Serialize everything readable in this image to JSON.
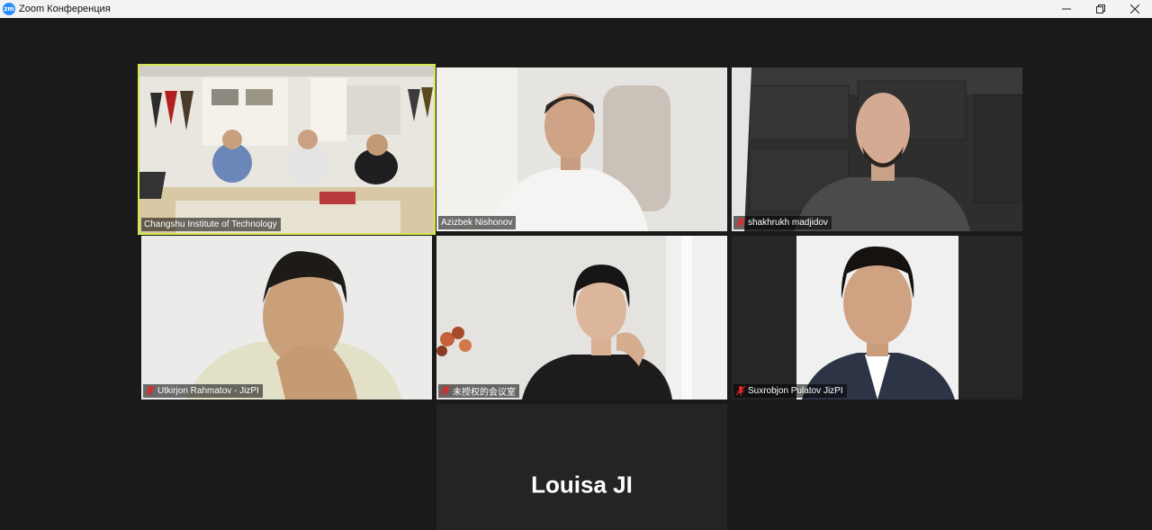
{
  "window": {
    "app_icon_text": "zm",
    "title": "Zoom Конференция",
    "minimize_icon": "minimize-icon",
    "restore_icon": "restore-icon",
    "close_icon": "close-icon"
  },
  "participants": [
    {
      "name": "Changshu Institute of Technology",
      "muted": false,
      "active_speaker": true
    },
    {
      "name": "Azizbek Nishonov",
      "muted": false,
      "active_speaker": false
    },
    {
      "name": "shakhrukh madjidov",
      "muted": true,
      "active_speaker": false
    },
    {
      "name": "Utkirjon Rahmatov - JizPI",
      "muted": true,
      "active_speaker": false
    },
    {
      "name": "未授权的会议室",
      "muted": true,
      "active_speaker": false
    },
    {
      "name": "Suxrobjon  Pulatov JizPI",
      "muted": true,
      "active_speaker": false
    }
  ],
  "no_video_participant": {
    "name": "Louisa JI"
  },
  "colors": {
    "active_border": "#d8e84a",
    "muted_mic": "#e02828",
    "background": "#1a1a1a"
  }
}
